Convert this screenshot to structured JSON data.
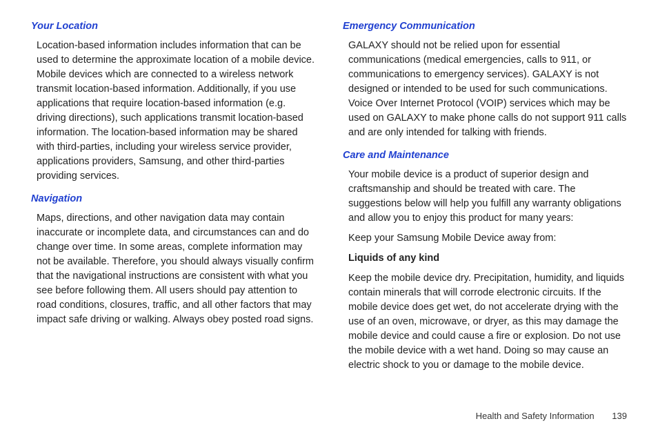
{
  "left_column": {
    "section1": {
      "heading": "Your Location",
      "body": "Location-based information includes information that can be used to determine the approximate location of a mobile device.  Mobile devices which are connected to a wireless network transmit location-based information.  Additionally, if you use applications that require location-based information (e.g. driving directions), such applications transmit location-based information.  The location-based information may be shared with third-parties, including your wireless service provider, applications providers, Samsung, and other third-parties providing services."
    },
    "section2": {
      "heading": "Navigation",
      "body": "Maps, directions, and other navigation data may contain inaccurate or incomplete data, and circumstances can and do change over time.  In some areas, complete information may not be available.  Therefore, you should always visually confirm that the navigational instructions are consistent with what you see before following them.  All users should pay attention to road conditions, closures, traffic, and all other factors that may impact safe driving or walking.  Always obey posted road signs."
    }
  },
  "right_column": {
    "section1": {
      "heading": "Emergency Communication",
      "body": "GALAXY should not be relied upon for essential communications (medical emergencies, calls to 911, or communications to emergency services).  GALAXY is not designed or intended to be used for such communications.  Voice Over Internet Protocol (VOIP) services which may be used on GALAXY to make phone calls do not support 911 calls and are only intended for talking with friends."
    },
    "section2": {
      "heading": "Care and Maintenance",
      "body1": "Your mobile device is a product of superior design and craftsmanship and should be treated with care.  The suggestions below will help you fulfill any warranty obligations and allow you to enjoy this product for many years:",
      "body2": "Keep your Samsung Mobile Device away from:",
      "subheading": "Liquids of any kind",
      "body3": "Keep the mobile device dry.  Precipitation, humidity, and liquids contain minerals that will corrode electronic circuits.  If the mobile device does get wet, do not accelerate drying with the use of an oven, microwave, or dryer, as this may damage the mobile device and could cause a fire or explosion.  Do not use the mobile device with a wet hand.  Doing so may cause an electric shock to you or damage to the mobile device."
    }
  },
  "footer": {
    "section_title": "Health and Safety Information",
    "page_number": "139"
  }
}
